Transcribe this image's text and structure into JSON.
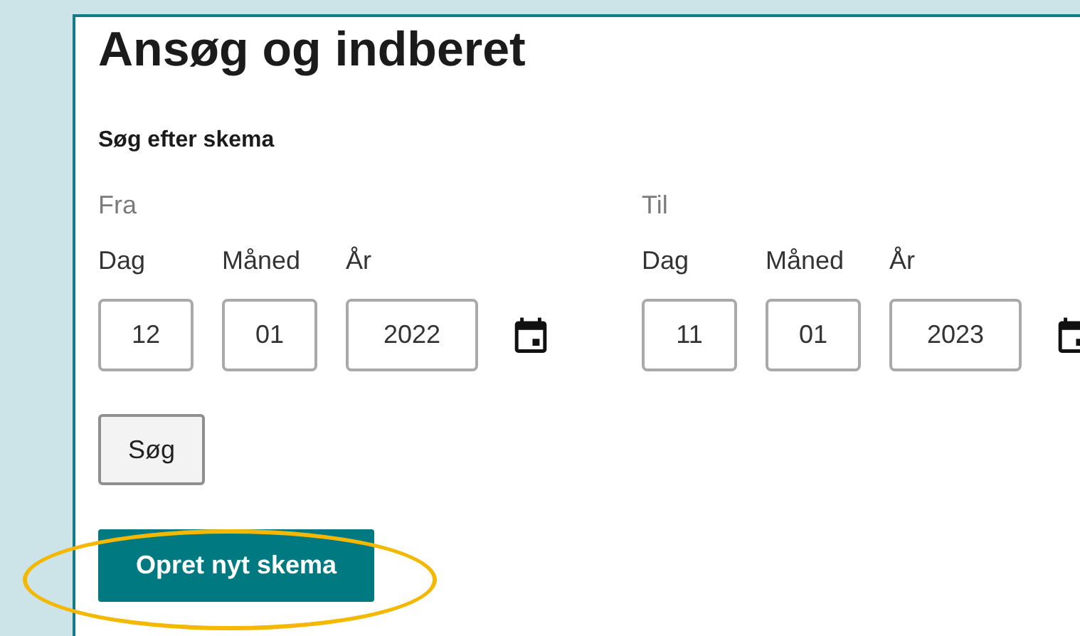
{
  "heading": "Ansøg og indberet",
  "search_section": {
    "title": "Søg efter skema",
    "date_ranges": [
      {
        "label": "Fra",
        "fields": [
          {
            "label": "Dag",
            "value": "12"
          },
          {
            "label": "Måned",
            "value": "01"
          },
          {
            "label": "År",
            "value": "2022"
          }
        ]
      },
      {
        "label": "Til",
        "fields": [
          {
            "label": "Dag",
            "value": "11"
          },
          {
            "label": "Måned",
            "value": "01"
          },
          {
            "label": "År",
            "value": "2023"
          }
        ]
      }
    ],
    "search_button": "Søg"
  },
  "create_button": {
    "label": "Opret nyt skema",
    "highlighted": true
  }
}
